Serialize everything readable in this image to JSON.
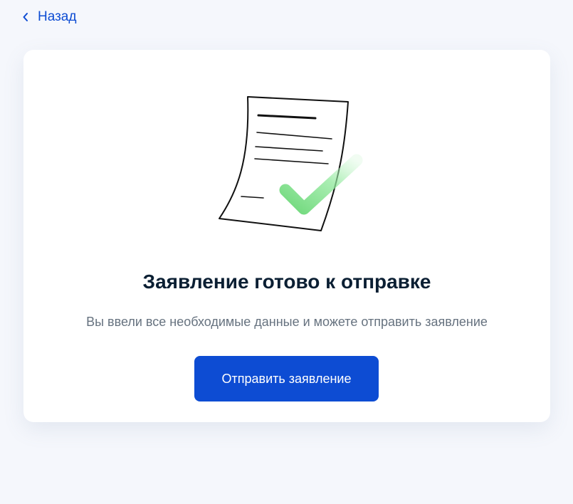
{
  "nav": {
    "back_label": "Назад"
  },
  "card": {
    "title": "Заявление готово к отправке",
    "subtitle": "Вы ввели все необходимые данные и можете отправить заявление",
    "submit_label": "Отправить заявление",
    "illustration_icon": "document-check-icon"
  },
  "colors": {
    "accent": "#0d4cd3",
    "background": "#f5f7fc",
    "title": "#0b1f33",
    "subtitle": "#66727f",
    "check": "#7ee38a"
  }
}
